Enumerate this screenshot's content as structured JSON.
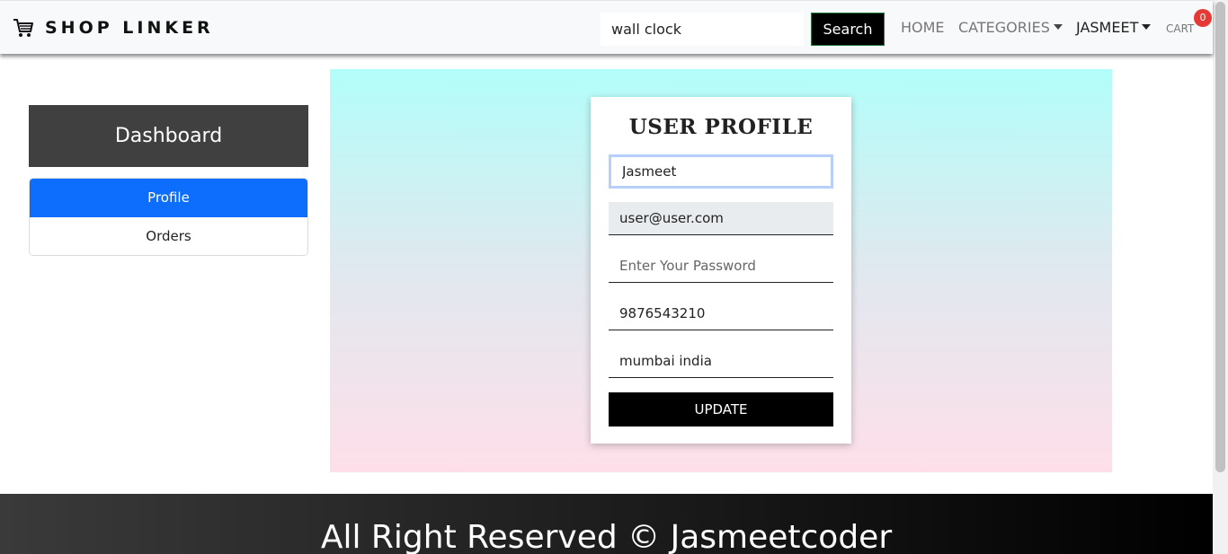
{
  "navbar": {
    "brand_icon": "shopping-cart-icon",
    "brand": "SHOP LINKER",
    "search": {
      "value": "wall clock",
      "button_label": "Search"
    },
    "links": {
      "home": "HOME",
      "categories": "CATEGORIES",
      "user": "JASMEET",
      "cart": "CART"
    },
    "cart_count": "0",
    "badge_color": "#e53935"
  },
  "sidebar": {
    "header": "Dashboard",
    "items": [
      {
        "label": "Profile",
        "active": true
      },
      {
        "label": "Orders",
        "active": false
      }
    ],
    "active_color": "#0d6efd"
  },
  "profile": {
    "title": "USER PROFILE",
    "name_value": "Jasmeet",
    "email_value": "user@user.com",
    "password_placeholder": "Enter Your Password",
    "phone_value": "9876543210",
    "address_value": "mumbai india",
    "update_label": "UPDATE"
  },
  "footer": {
    "text": "All Right Reserved © Jasmeetcoder"
  }
}
